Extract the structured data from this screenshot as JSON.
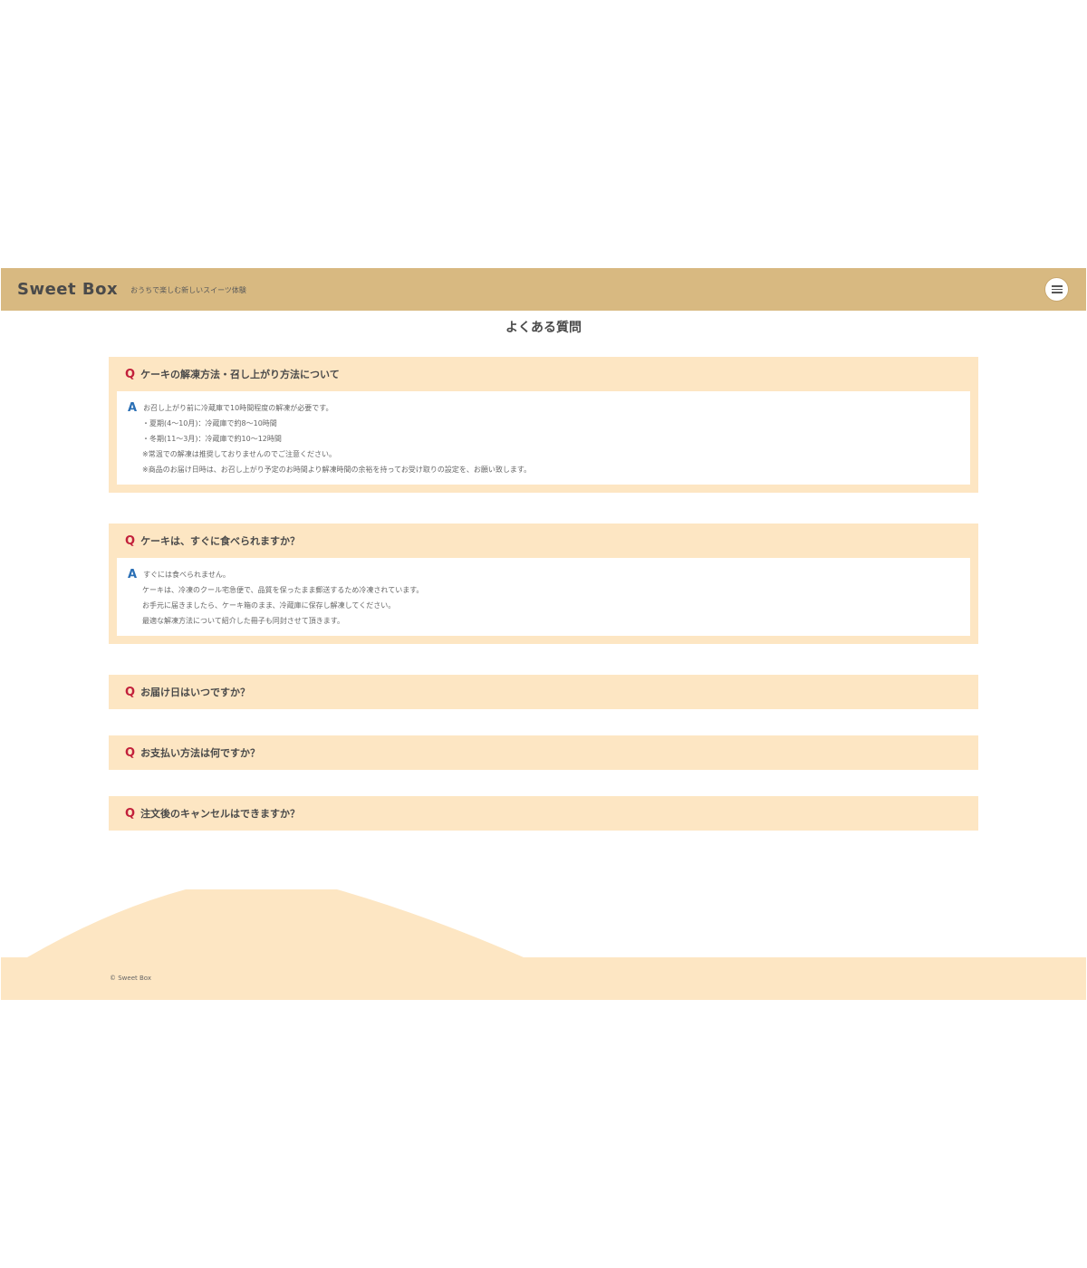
{
  "header": {
    "logo": "Sweet Box",
    "tagline": "おうちで楽しむ新しいスイーツ体験",
    "menu_icon": "hamburger-menu-icon"
  },
  "page_title": "よくある質問",
  "faq": [
    {
      "question": "ケーキの解凍方法・召し上がり方法について",
      "answer_first": "お召し上がり前に冷蔵庫で10時間程度の解凍が必要です。",
      "answer_lines": [
        "・夏期(4～10月)：冷蔵庫で約8～10時間",
        "・冬期(11～3月)：冷蔵庫で約10～12時間",
        "※常温での解凍は推奨しておりませんのでご注意ください。",
        "※商品のお届け日時は、お召し上がり予定のお時間より解凍時間の余裕を持ってお受け取りの設定を、お願い致します。"
      ]
    },
    {
      "question": "ケーキは、すぐに食べられますか？",
      "answer_first": "すぐには食べられません。",
      "answer_lines": [
        "ケーキは、冷凍のクール宅急便で、品質を保ったまま郵送するため冷凍されています。",
        "お手元に届きましたら、ケーキ箱のまま、冷蔵庫に保存し解凍してください。",
        "最適な解凍方法について紹介した冊子も同封させて頂きます。"
      ]
    },
    {
      "question": "お届け日はいつですか？"
    },
    {
      "question": "お支払い方法は何ですか？"
    },
    {
      "question": "注文後のキャンセルはできますか？"
    }
  ],
  "labels": {
    "q": "Q",
    "a": "A"
  },
  "footer": {
    "copyright": "© Sweet Box"
  },
  "colors": {
    "header_bg": "#d8b981",
    "faq_bg": "#fde6c3",
    "q_mark": "#c2203b",
    "a_mark": "#2a6fb5"
  }
}
